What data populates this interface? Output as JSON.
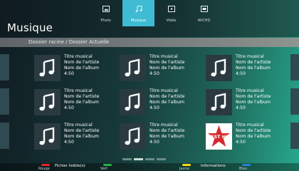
{
  "header": {
    "title": "Musique",
    "tabs": [
      {
        "label": "Photo",
        "icon": "photo-icon",
        "active": false
      },
      {
        "label": "Musique",
        "icon": "music-note-icon",
        "active": true
      },
      {
        "label": "Vidéo",
        "icon": "video-icon",
        "active": false
      },
      {
        "label": "AVCHD",
        "icon": "avchd-icon",
        "active": false
      }
    ]
  },
  "path": "Dossier racine / Dossier Actuelle",
  "items": [
    {
      "title": "Titre musical",
      "artist": "Nom de l'artiste",
      "album": "Nom de l'album",
      "duration": "4:50",
      "art": "music-note-icon"
    },
    {
      "title": "Titre musical",
      "artist": "Nom de l'artiste",
      "album": "Nom de l'album",
      "duration": "4:50",
      "art": "music-note-icon"
    },
    {
      "title": "Titre musical",
      "artist": "Nom de l'artiste",
      "album": "Nom de l'album",
      "duration": "4:50",
      "art": "music-note-icon"
    },
    {
      "title": "Titre musical",
      "artist": "Nom de l'artiste",
      "album": "Nom de l'album",
      "duration": "4:50",
      "art": "music-note-icon"
    },
    {
      "title": "Titre musical",
      "artist": "Nom de l'artiste",
      "album": "Nom de l'album",
      "duration": "4:50",
      "art": "music-note-icon"
    },
    {
      "title": "Titre musical",
      "artist": "Nom de l'artiste",
      "album": "Nom de l'album",
      "duration": "4:50",
      "art": "music-note-icon"
    },
    {
      "title": "Titre musical",
      "artist": "Nom de l'artiste",
      "album": "Nom de l'album",
      "duration": "4:50",
      "art": "music-note-icon"
    },
    {
      "title": "Titre musical",
      "artist": "Nom de l'artiste",
      "album": "Nom de l'album",
      "duration": "4:50",
      "art": "music-note-icon"
    },
    {
      "title": "Titre musical",
      "artist": "Nom de l'artiste",
      "album": "Nom de l'album",
      "duration": "4:50",
      "art": "best-hit-album-art",
      "art_text": "BEST HIT"
    }
  ],
  "pager": {
    "pages": 4,
    "current": 2
  },
  "footer": {
    "keys": [
      {
        "color": "#e8202a",
        "label": "Rouge"
      },
      {
        "color": "#27b24a",
        "label": "Vert"
      },
      {
        "color": "#f2dc16",
        "label": "Jaune"
      },
      {
        "color": "#2a7fd6",
        "label": "Bleu"
      }
    ],
    "red_text": "Fichier lisible(s)",
    "yellow_text": "Informations"
  },
  "colors": {
    "accent": "#3fbcd4",
    "thumb_bg": "#2a3a40"
  }
}
